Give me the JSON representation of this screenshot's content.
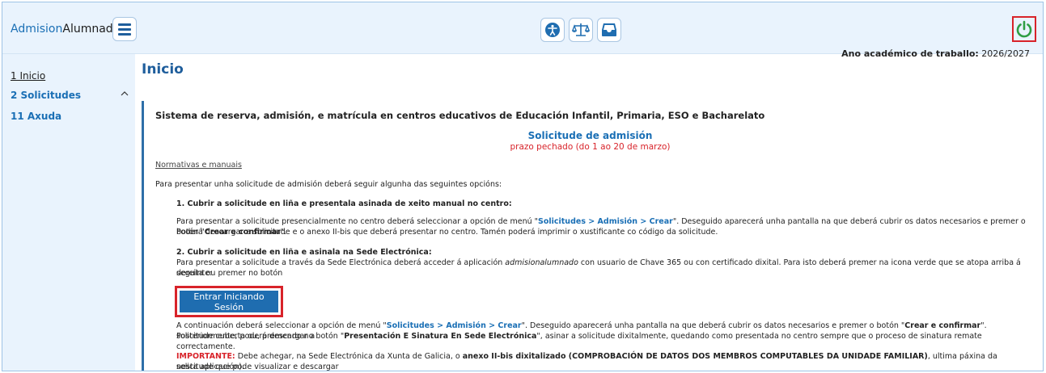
{
  "header": {
    "brand_part1": "Admision",
    "brand_part2": "Alumnado",
    "icons": [
      "menu-icon",
      "accessibility-icon",
      "scales-icon",
      "inbox-icon",
      "power-icon"
    ],
    "power_color": "#2f9e44",
    "accent": "#1f6db0"
  },
  "sidebar": {
    "items": [
      {
        "label": "1 Inicio"
      },
      {
        "label": "2 Solicitudes"
      },
      {
        "label": "11 Axuda"
      }
    ]
  },
  "main": {
    "title": "Inicio",
    "ano_label": "Ano académico de traballo:",
    "ano_value": "2026/2027",
    "heading": "Sistema de reserva, admisión, e matrícula en centros educativos de Educación Infantil, Primaria, ESO e Bacharelato",
    "sol_title": "Solicitude de admisión",
    "sol_sub": "prazo pechado (do 1 ao 20 de marzo)",
    "link_normativas": "Normativas e manuais",
    "intro": "Para presentar unha solicitude de admisión deberá seguir algunha das seguintes opcións:",
    "opt1_title": "1. Cubrir a solicitude en liña e presentala asinada de xeito manual no centro:",
    "opt1_p1a": "Para presentar a solicitude presencialmente no centro deberá seleccionar a opción de menú \"",
    "opt1_menu": "Solicitudes > Admisión > Crear",
    "opt1_p1b": "\". Deseguido aparecerá unha pantalla na que deberá cubrir os datos necesarios e premer o botón \"",
    "opt1_btn": "Crear e confirmar",
    "opt1_p1c": "\".",
    "opt1_p2": "Poderá descargar a solicitude e o anexo II-bis que deberá presentar no centro. Tamén poderá imprimir o xustificante co código da solicitude.",
    "opt2_title": "2. Cubrir a solicitude en liña e asinala na Sede Electrónica:",
    "opt2_p1a": "Para presentar a solicitude a través da Sede Electrónica deberá acceder á aplicación ",
    "opt2_app": "admisionalumnado",
    "opt2_p1b": " con usuario de Chave 365 ou con certificado dixital. Para isto deberá premer na icona verde que se atopa arriba á dereita ou premer no botón",
    "opt2_p2": "seguinte:",
    "enter_button": "Entrar Iniciando Sesión",
    "cont_a": "A continuación deberá seleccionar a opción de menú \"",
    "cont_menu": "Solicitudes > Admisión > Crear",
    "cont_b": "\". Deseguido aparecerá unha pantalla na que deberá cubrir os datos necesarios e premer o botón \"",
    "cont_btn": "Crear e confirmar",
    "cont_c": "\". Posteriormente, poderá descargar a",
    "cont2_a": "solicitude cuberta ou, premendo no botón \"",
    "cont2_btn": "Presentación E Sinatura En Sede Electrónica",
    "cont2_b": "\", asinar a solicitude dixitalmente, quedando como presentada no centro sempre que o proceso de sinatura remate correctamente.",
    "imp_label": "IMPORTANTE:",
    "imp_a": " Debe achegar, na Sede Electrónica da Xunta de Galicia, o ",
    "imp_bold": "anexo II-bis dixitalizado (COMPROBACIÓN DE DATOS DOS MEMBROS COMPUTABLES DA UNIDADE FAMILIAR)",
    "imp_b": ", ultima páxina da solicitude que pode visualizar e descargar",
    "imp2": "nesta aplicación)."
  }
}
